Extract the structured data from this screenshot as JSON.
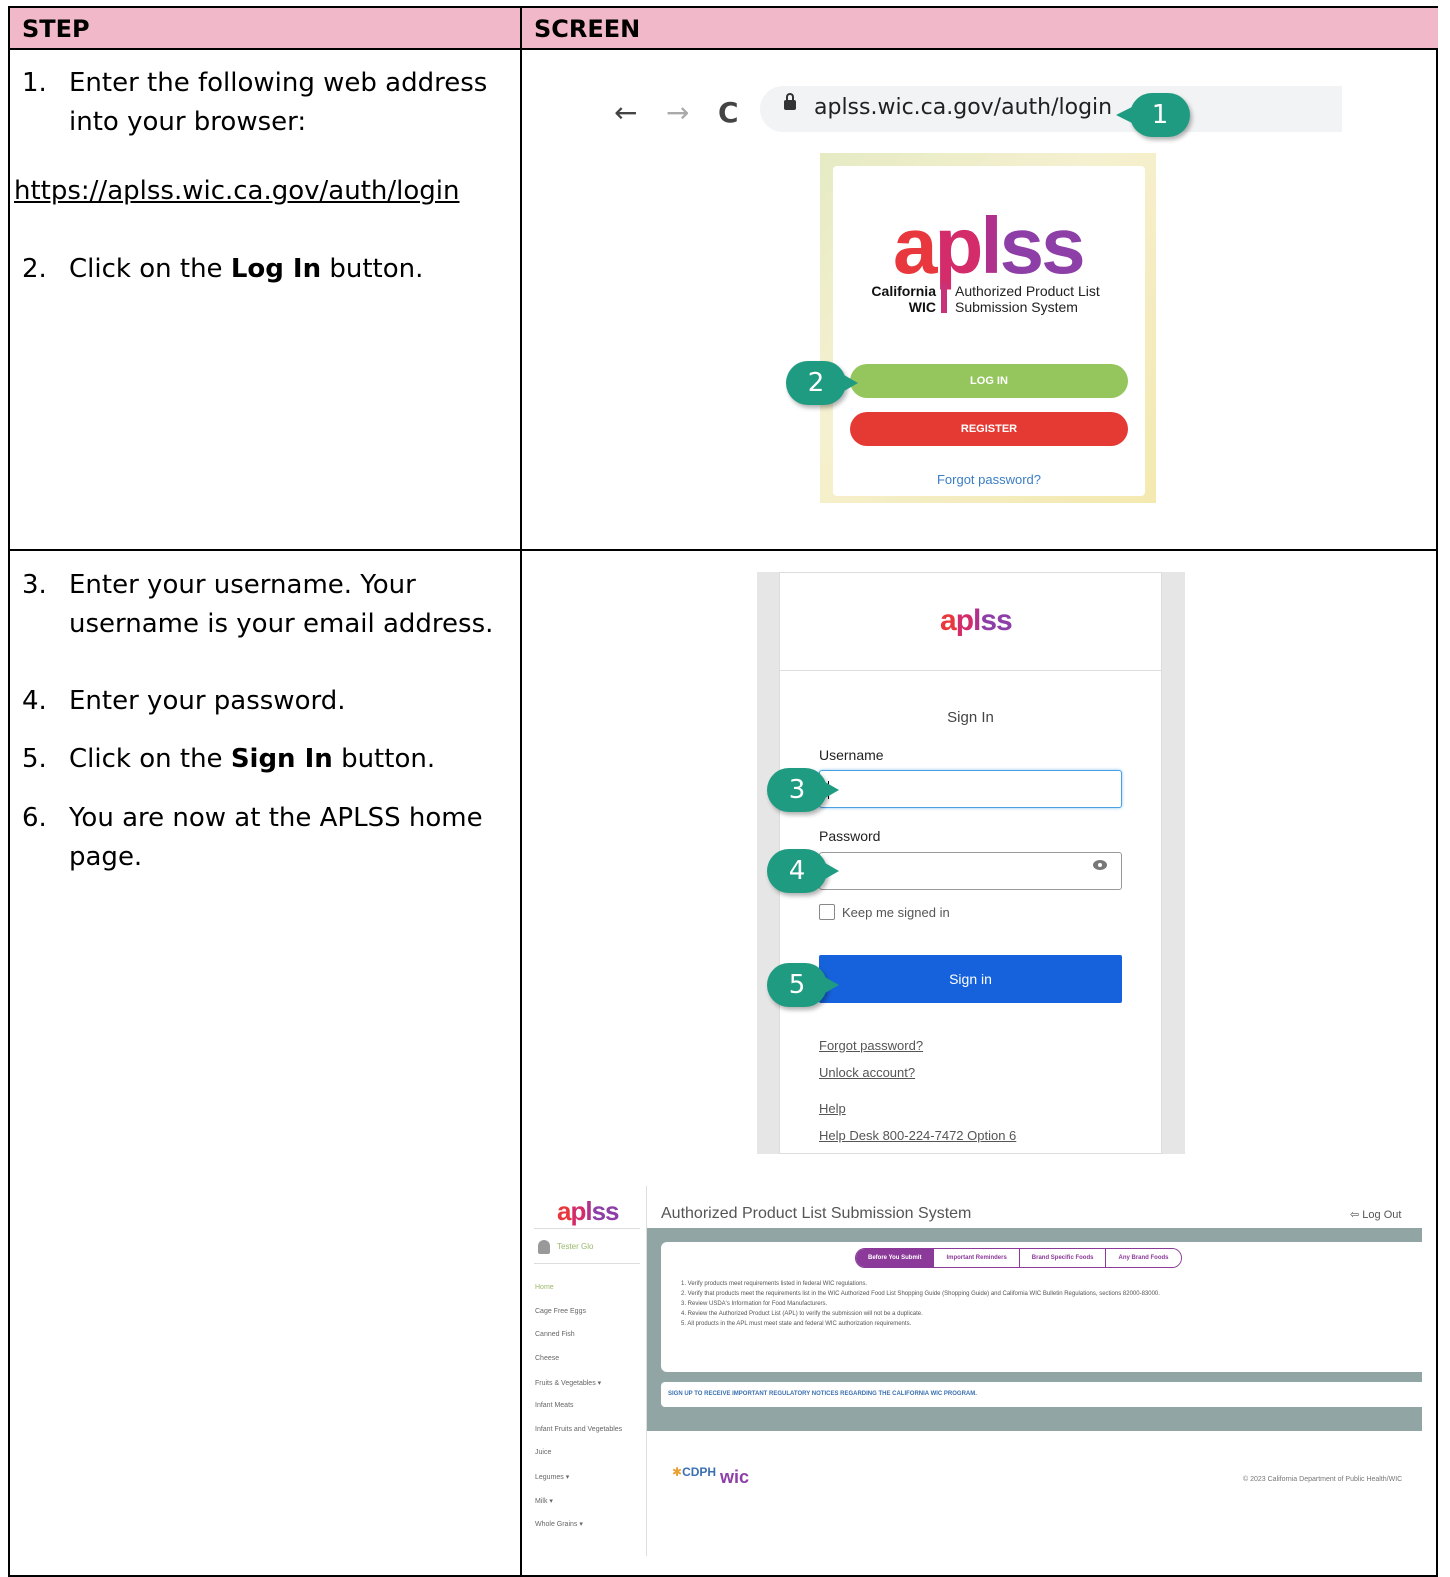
{
  "table": {
    "header_step": "STEP",
    "header_screen": "SCREEN"
  },
  "row1": {
    "step1_num": "1.",
    "step1_text": "Enter the following web address into your browser:",
    "url": "https://aplss.wic.ca.gov/auth/login",
    "step2_num": "2.",
    "step2_pre": "Click on the ",
    "step2_bold": "Log In",
    "step2_post": " button."
  },
  "row2": {
    "step3_num": "3.",
    "step3_text": "Enter your username.  Your username is your email address.",
    "step4_num": "4.",
    "step4_text": "Enter your password.",
    "step5_num": "5.",
    "step5_pre": "Click on the ",
    "step5_bold": "Sign In",
    "step5_post": " button.",
    "step6_num": "6.",
    "step6_text": "You are now at the APLSS home page."
  },
  "browser": {
    "address": "aplss.wic.ca.gov/auth/login",
    "back_glyph": "←",
    "forward_glyph": "→",
    "reload_glyph": "C"
  },
  "callouts": [
    "1",
    "2",
    "3",
    "4",
    "5"
  ],
  "login_card": {
    "logo": [
      "a",
      "p",
      "l",
      "ss"
    ],
    "ca_wic": "California WIC",
    "subtitle": "Authorized Product List Submission System",
    "login_label": "LOG IN",
    "register_label": "REGISTER",
    "forgot": "Forgot password?"
  },
  "okta": {
    "logo": [
      "a",
      "p",
      "l",
      "ss"
    ],
    "title": "Sign In",
    "username_label": "Username",
    "password_label": "Password",
    "keep_signed_in": "Keep me signed in",
    "signin_button": "Sign in",
    "forgot": "Forgot password?",
    "unlock": "Unlock account?",
    "help": "Help",
    "helpdesk": "Help Desk 800-224-7472 Option 6"
  },
  "home": {
    "logo": [
      "a",
      "p",
      "l",
      "ss"
    ],
    "title": "Authorized Product List Submission System",
    "logout": "Log Out",
    "user": "Tester Glo",
    "sidebar": [
      "Home",
      "Cage Free Eggs",
      "Canned Fish",
      "Cheese",
      "Fruits & Vegetables ▾",
      "Infant Meats",
      "Infant Fruits and Vegetables",
      "Juice",
      "Legumes ▾",
      "Milk ▾",
      "Whole Grains ▾"
    ],
    "tabs": [
      "Before You Submit",
      "Important Reminders",
      "Brand Specific Foods",
      "Any Brand Foods"
    ],
    "list": [
      "1. Verify products meet requirements listed in federal WIC regulations.",
      "2. Verify that products meet the requirements list in the WIC Authorized Food List Shopping Guide (Shopping Guide) and California WIC Bulletin Regulations, sections 82000-83000.",
      "3. Review USDA's Information for Food Manufacturers.",
      "4. Review the Authorized Product List (APL) to verify the submission will not be a duplicate.",
      "5. All products in the APL must meet state and federal WIC authorization requirements."
    ],
    "notice": "SIGN UP TO RECEIVE IMPORTANT REGULATORY NOTICES REGARDING THE CALIFORNIA WIC PROGRAM.",
    "cdph": "CDPH",
    "wic": "wic",
    "copyright": "© 2023 California Department of Public Health/WIC"
  }
}
